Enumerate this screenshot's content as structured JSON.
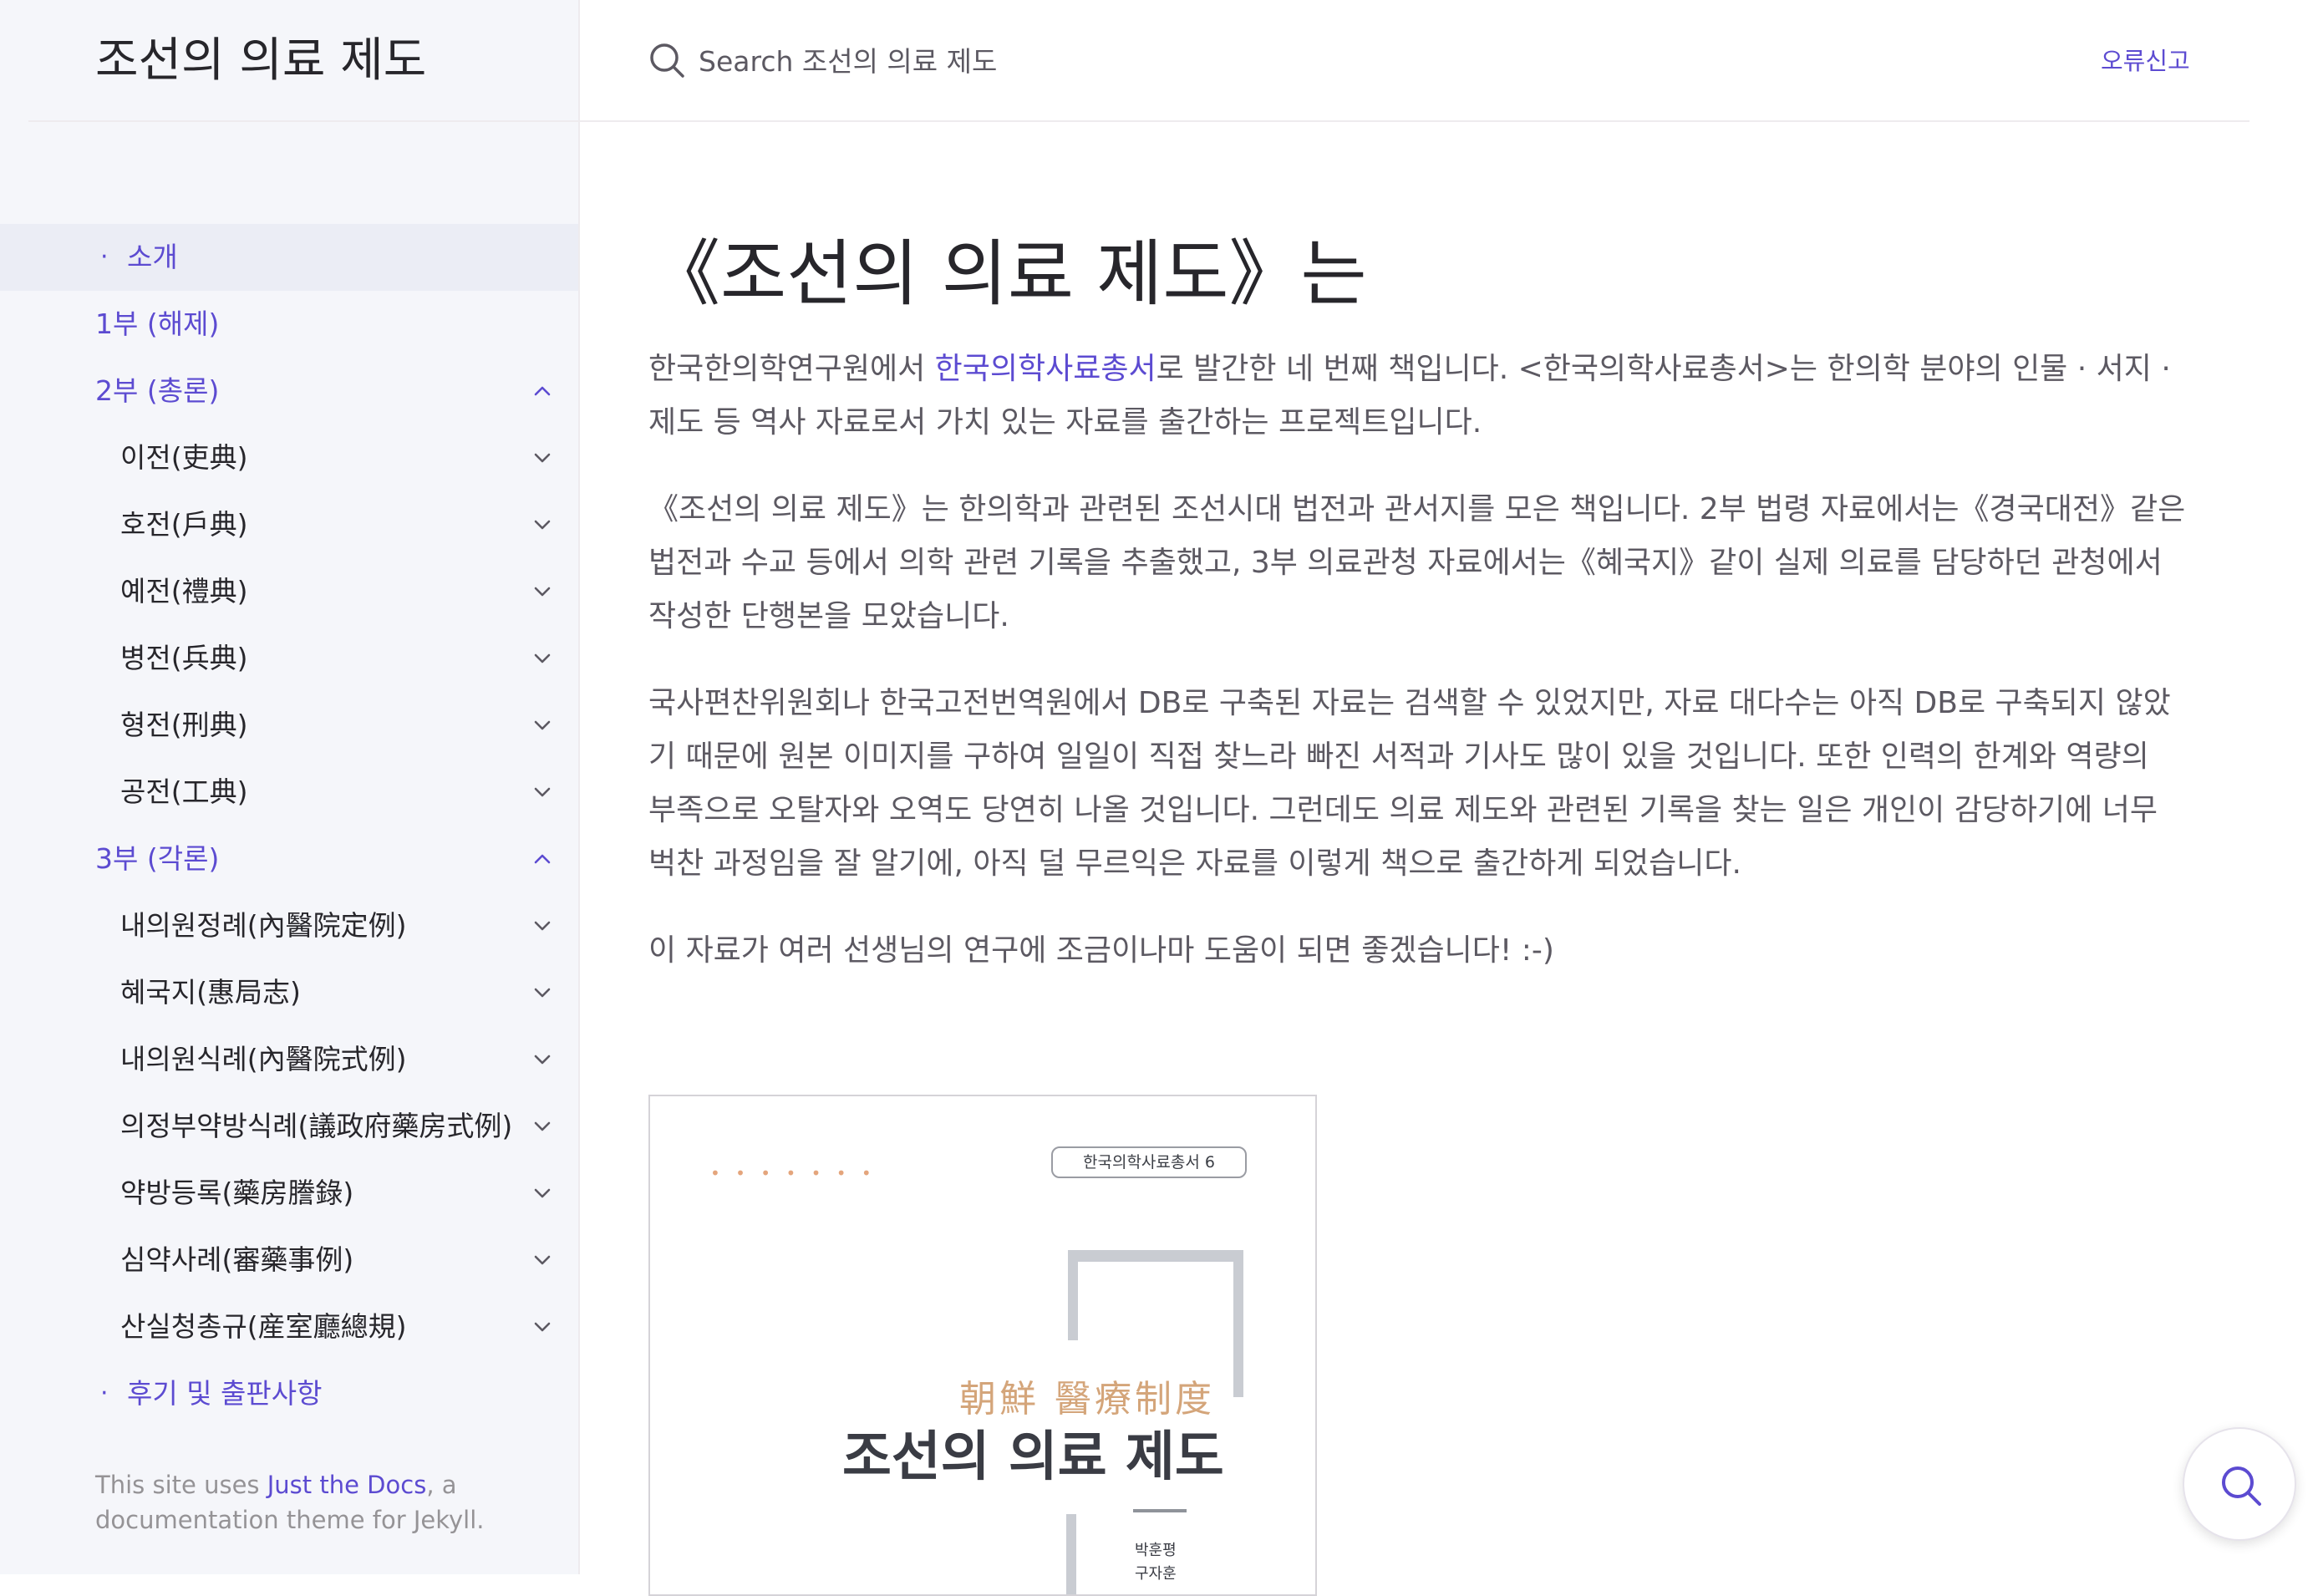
{
  "site": {
    "title": "조선의 의료 제도"
  },
  "search": {
    "placeholder": "Search 조선의 의료 제도"
  },
  "header": {
    "report_link": "오류신고"
  },
  "nav": {
    "items": [
      {
        "label": "소개",
        "type": "bullet",
        "active": true
      },
      {
        "label": "1부 (해제)",
        "type": "top"
      },
      {
        "label": "2부 (총론)",
        "type": "top",
        "expanded": true
      },
      {
        "label": "이전(吏典)",
        "type": "sub"
      },
      {
        "label": "호전(戶典)",
        "type": "sub"
      },
      {
        "label": "예전(禮典)",
        "type": "sub"
      },
      {
        "label": "병전(兵典)",
        "type": "sub"
      },
      {
        "label": "형전(刑典)",
        "type": "sub"
      },
      {
        "label": "공전(工典)",
        "type": "sub"
      },
      {
        "label": "3부 (각론)",
        "type": "top",
        "expanded": true
      },
      {
        "label": "내의원정례(內醫院定例)",
        "type": "sub"
      },
      {
        "label": "혜국지(惠局志)",
        "type": "sub"
      },
      {
        "label": "내의원식례(內醫院式例)",
        "type": "sub"
      },
      {
        "label": "의정부약방식례(議政府藥房式例)",
        "type": "sub"
      },
      {
        "label": "약방등록(藥房謄錄)",
        "type": "sub"
      },
      {
        "label": "심약사례(審藥事例)",
        "type": "sub"
      },
      {
        "label": "산실청총규(産室廳總規)",
        "type": "sub"
      },
      {
        "label": "후기 및 출판사항",
        "type": "bullet"
      }
    ],
    "bullet_symbol": "·"
  },
  "footer": {
    "prefix": "This site uses ",
    "link": "Just the Docs",
    "suffix": ", a documentation theme for Jekyll."
  },
  "content": {
    "title": "《조선의 의료 제도》는",
    "p1_before": "한국한의학연구원에서 ",
    "p1_link": "한국의학사료총서",
    "p1_after": "로 발간한 네 번째 책입니다. <한국의학사료총서>는 한의학 분야의 인물 · 서지 · 제도 등 역사 자료로서 가치 있는 자료를 출간하는 프로젝트입니다.",
    "p2": "《조선의 의료 제도》는 한의학과 관련된 조선시대 법전과 관서지를 모은 책입니다. 2부 법령 자료에서는《경국대전》같은 법전과 수교 등에서 의학 관련 기록을 추출했고, 3부 의료관청 자료에서는《혜국지》같이 실제 의료를 담당하던 관청에서 작성한 단행본을 모았습니다.",
    "p3": "국사편찬위원회나 한국고전번역원에서 DB로 구축된 자료는 검색할 수 있었지만, 자료 대다수는 아직 DB로 구축되지 않았기 때문에 원본 이미지를 구하여 일일이 직접 찾느라 빠진 서적과 기사도 많이 있을 것입니다. 또한 인력의 한계와 역량의 부족으로 오탈자와 오역도 당연히 나올 것입니다. 그런데도 의료 제도와 관련된 기록을 찾는 일은 개인이 감당하기에 너무 벅찬 과정임을 잘 알기에, 아직 덜 무르익은 자료를 이렇게 책으로 출간하게 되었습니다.",
    "p4": "이 자료가 여러 선생님의 연구에 조금이나마 도움이 되면 좋겠습니다! :-)"
  },
  "cover": {
    "dots": "• • • • • • •",
    "series": "한국의학사료총서 6",
    "hanja": "朝鮮  醫療制度",
    "title": "조선의 의료 제도",
    "author1": "박훈평",
    "author2": "구자훈"
  },
  "colors": {
    "accent": "#5c4bd1",
    "sidebar_bg": "#f5f6fa",
    "text": "#5c5962",
    "heading": "#27262b"
  },
  "icons": {
    "search": "search-icon",
    "chevron_down": "chevron-down-icon",
    "chevron_up": "chevron-up-icon"
  }
}
